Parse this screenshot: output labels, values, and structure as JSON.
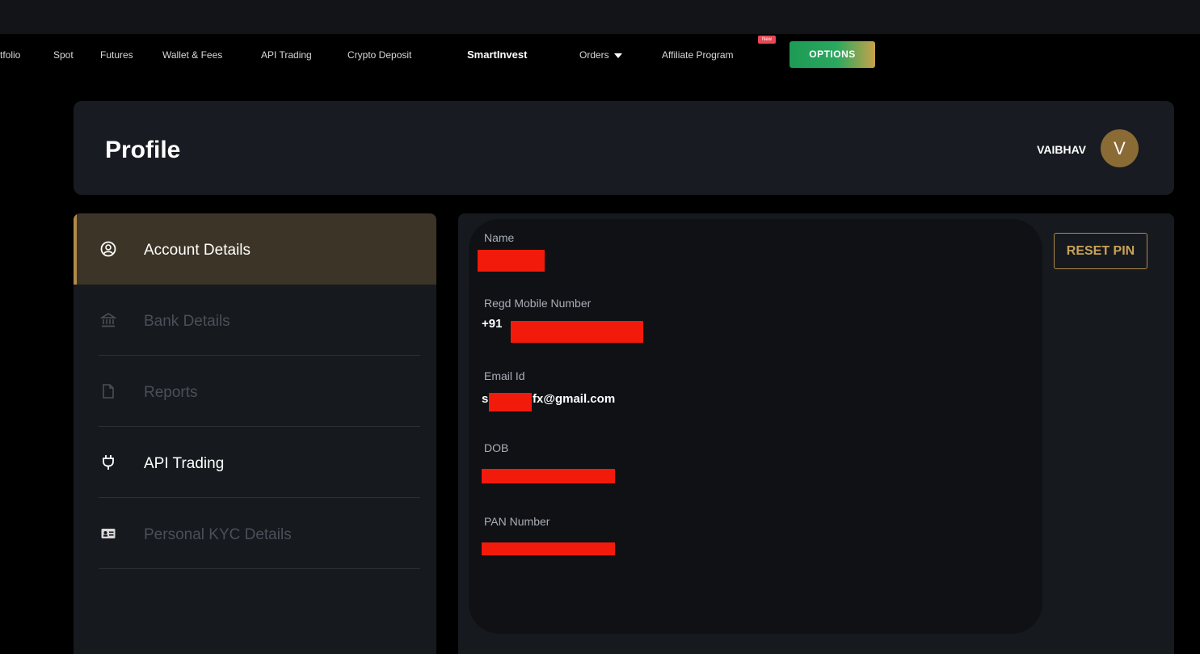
{
  "nav": {
    "items": [
      {
        "label": "tfolio",
        "bold": false
      },
      {
        "label": "Spot",
        "bold": false
      },
      {
        "label": "Futures",
        "bold": false
      },
      {
        "label": "Wallet & Fees",
        "bold": false
      },
      {
        "label": "API Trading",
        "bold": false
      },
      {
        "label": "Crypto Deposit",
        "bold": false
      },
      {
        "label": "SmartInvest",
        "bold": true
      },
      {
        "label": "Orders",
        "bold": false
      },
      {
        "label": "Affiliate Program",
        "bold": false
      }
    ],
    "new_badge": "New",
    "options_label": "OPTIONS"
  },
  "header": {
    "title": "Profile",
    "username": "VAIBHAV",
    "avatar_initial": "V"
  },
  "sidebar": {
    "items": [
      {
        "label": "Account Details",
        "icon": "user-circle-icon",
        "state": "active"
      },
      {
        "label": "Bank Details",
        "icon": "bank-icon",
        "state": "disabled"
      },
      {
        "label": "Reports",
        "icon": "document-icon",
        "state": "disabled"
      },
      {
        "label": "API Trading",
        "icon": "plug-icon",
        "state": "enabled"
      },
      {
        "label": "Personal KYC Details",
        "icon": "id-card-icon",
        "state": "disabled"
      }
    ]
  },
  "details": {
    "name_label": "Name",
    "mobile_label": "Regd Mobile Number",
    "mobile_prefix": "+91",
    "email_label": "Email Id",
    "email_prefix": "s",
    "email_suffix": "fx@gmail.com",
    "dob_label": "DOB",
    "pan_label": "PAN Number",
    "reset_label": "RESET PIN"
  },
  "colors": {
    "accent": "#b08a4a",
    "redaction": "#f21b0b",
    "options_green": "#1d9a55"
  }
}
